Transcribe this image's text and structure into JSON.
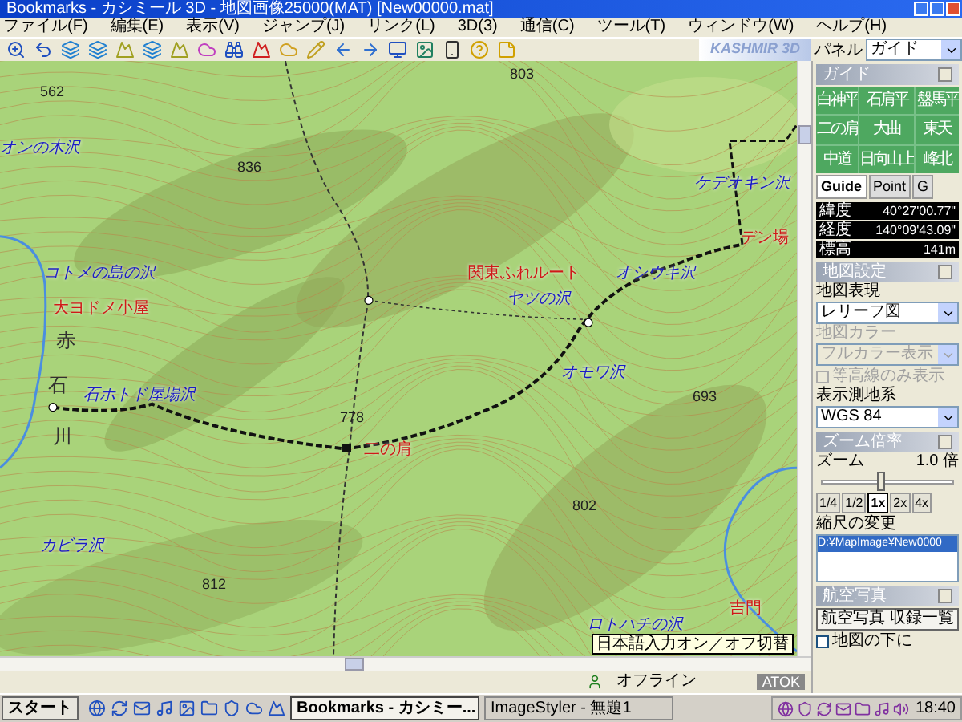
{
  "window": {
    "title": "Bookmarks - カシミール 3D - 地図画像25000(MAT) [New00000.mat]"
  },
  "menu": [
    "ファイル(F)",
    "編集(E)",
    "表示(V)",
    "ジャンプ(J)",
    "リンク(L)",
    "3D(3)",
    "通信(C)",
    "ツール(T)",
    "ウィンドウ(W)",
    "ヘルプ(H)"
  ],
  "toolbar": {
    "logo": "KASHMIR 3D",
    "panel_label": "パネル",
    "panel_value": "ガイド"
  },
  "map": {
    "labels": [
      {
        "text": "562",
        "kind": "elevation"
      },
      {
        "text": "オンの木沢",
        "kind": "stream"
      },
      {
        "text": "836",
        "kind": "elevation"
      },
      {
        "text": "803",
        "kind": "elevation"
      },
      {
        "text": "コトメの島の沢",
        "kind": "stream"
      },
      {
        "text": "大ヨドメ小屋",
        "kind": "place"
      },
      {
        "text": "赤",
        "kind": "river"
      },
      {
        "text": "石",
        "kind": "river"
      },
      {
        "text": "川",
        "kind": "river"
      },
      {
        "text": "石ホトド屋場沢",
        "kind": "stream"
      },
      {
        "text": "778",
        "kind": "elevation"
      },
      {
        "text": "二の肩",
        "kind": "place"
      },
      {
        "text": "カビラ沢",
        "kind": "stream"
      },
      {
        "text": "812",
        "kind": "elevation"
      },
      {
        "text": "ケデオキン沢",
        "kind": "stream"
      },
      {
        "text": "デン場",
        "kind": "place"
      },
      {
        "text": "関東ふれルート",
        "kind": "place"
      },
      {
        "text": "ヤツの沢",
        "kind": "stream"
      },
      {
        "text": "オシウキ沢",
        "kind": "stream"
      },
      {
        "text": "オモワ沢",
        "kind": "stream"
      },
      {
        "text": "693",
        "kind": "elevation"
      },
      {
        "text": "802",
        "kind": "elevation"
      },
      {
        "text": "ロトハチの沢",
        "kind": "stream"
      },
      {
        "text": "吉門",
        "kind": "place"
      }
    ],
    "tooltip": "日本語入力オン／オフ切替"
  },
  "panel": {
    "guide": {
      "title": "ガイド",
      "directions": [
        "白神平",
        "石肩平",
        "盤馬平",
        "二の肩",
        "大曲",
        "東天",
        "中道",
        "日向山上",
        "峰北"
      ],
      "tabs": [
        {
          "label": "Guide",
          "selected": true
        },
        {
          "label": "Point",
          "selected": false
        },
        {
          "label": "G",
          "selected": false
        }
      ],
      "coords": [
        {
          "label": "緯度",
          "value": "40°27'00.77\""
        },
        {
          "label": "経度",
          "value": "140°09'43.09\""
        },
        {
          "label": "標高",
          "value": "141m"
        }
      ]
    },
    "map_settings": {
      "title": "地図設定",
      "fields": [
        {
          "kind": "select",
          "label": "地図表現",
          "value": "レリーフ図",
          "disabled": false
        },
        {
          "kind": "select",
          "label": "地図カラー",
          "value": "フルカラー表示",
          "disabled": true
        },
        {
          "kind": "checkbox",
          "label": "等高線のみ表示",
          "checked": false,
          "disabled": true
        },
        {
          "kind": "select",
          "label": "表示測地系",
          "value": "WGS 84",
          "disabled": false
        }
      ]
    },
    "zoom": {
      "title": "ズーム倍率",
      "label": "ズーム",
      "reading": "1.0 倍",
      "level": 0.45,
      "buttons": [
        {
          "label": "1/4",
          "selected": false
        },
        {
          "label": "1/2",
          "selected": false
        },
        {
          "label": "1x",
          "selected": true
        },
        {
          "label": "2x",
          "selected": false
        },
        {
          "label": "4x",
          "selected": false
        }
      ],
      "scale_label": "縮尺の変更",
      "files": [
        {
          "text": "D:¥MapImage¥New0000",
          "selected": true
        }
      ]
    },
    "photo": {
      "title": "航空写真",
      "button": "航空写真 収録一覧"
    },
    "under": {
      "label": "地図の下に",
      "checked": false
    }
  },
  "status_bar": {
    "status": "オフライン",
    "ime": "ATOK"
  },
  "taskbar": {
    "start": "スタート",
    "tasks": [
      {
        "label": "Bookmarks - カシミー...",
        "selected": true
      },
      {
        "label": "ImageStyler - 無題1",
        "selected": false
      }
    ],
    "clock": "18:40"
  }
}
